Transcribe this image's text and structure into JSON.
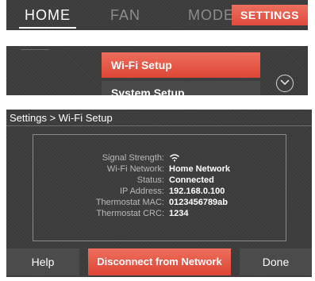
{
  "nav": {
    "tabs": [
      {
        "label": "HOME"
      },
      {
        "label": "FAN"
      },
      {
        "label": "MODE"
      },
      {
        "label": "SETTINGS"
      }
    ]
  },
  "menu": {
    "items": [
      {
        "label": "Wi-Fi Setup"
      },
      {
        "label": "System Setup"
      }
    ]
  },
  "wifi_screen": {
    "breadcrumb": "Settings > Wi-Fi Setup",
    "rows": [
      {
        "label": "Signal Strength:",
        "icon": "wifi-signal-icon"
      },
      {
        "label": "Wi-Fi Network:",
        "value": "Home Network"
      },
      {
        "label": "Status:",
        "value": "Connected"
      },
      {
        "label": "IP Address:",
        "value": "192.168.0.100"
      },
      {
        "label": "Thermostat MAC:",
        "value": "0123456789ab"
      },
      {
        "label": "Thermostat CRC:",
        "value": "1234"
      }
    ],
    "buttons": {
      "help": "Help",
      "disconnect": "Disconnect from Network",
      "done": "Done"
    }
  },
  "colors": {
    "accent": "#e04a3b",
    "panel_bg": "#3b3b3b",
    "button_bg": "#4b4b4b"
  }
}
